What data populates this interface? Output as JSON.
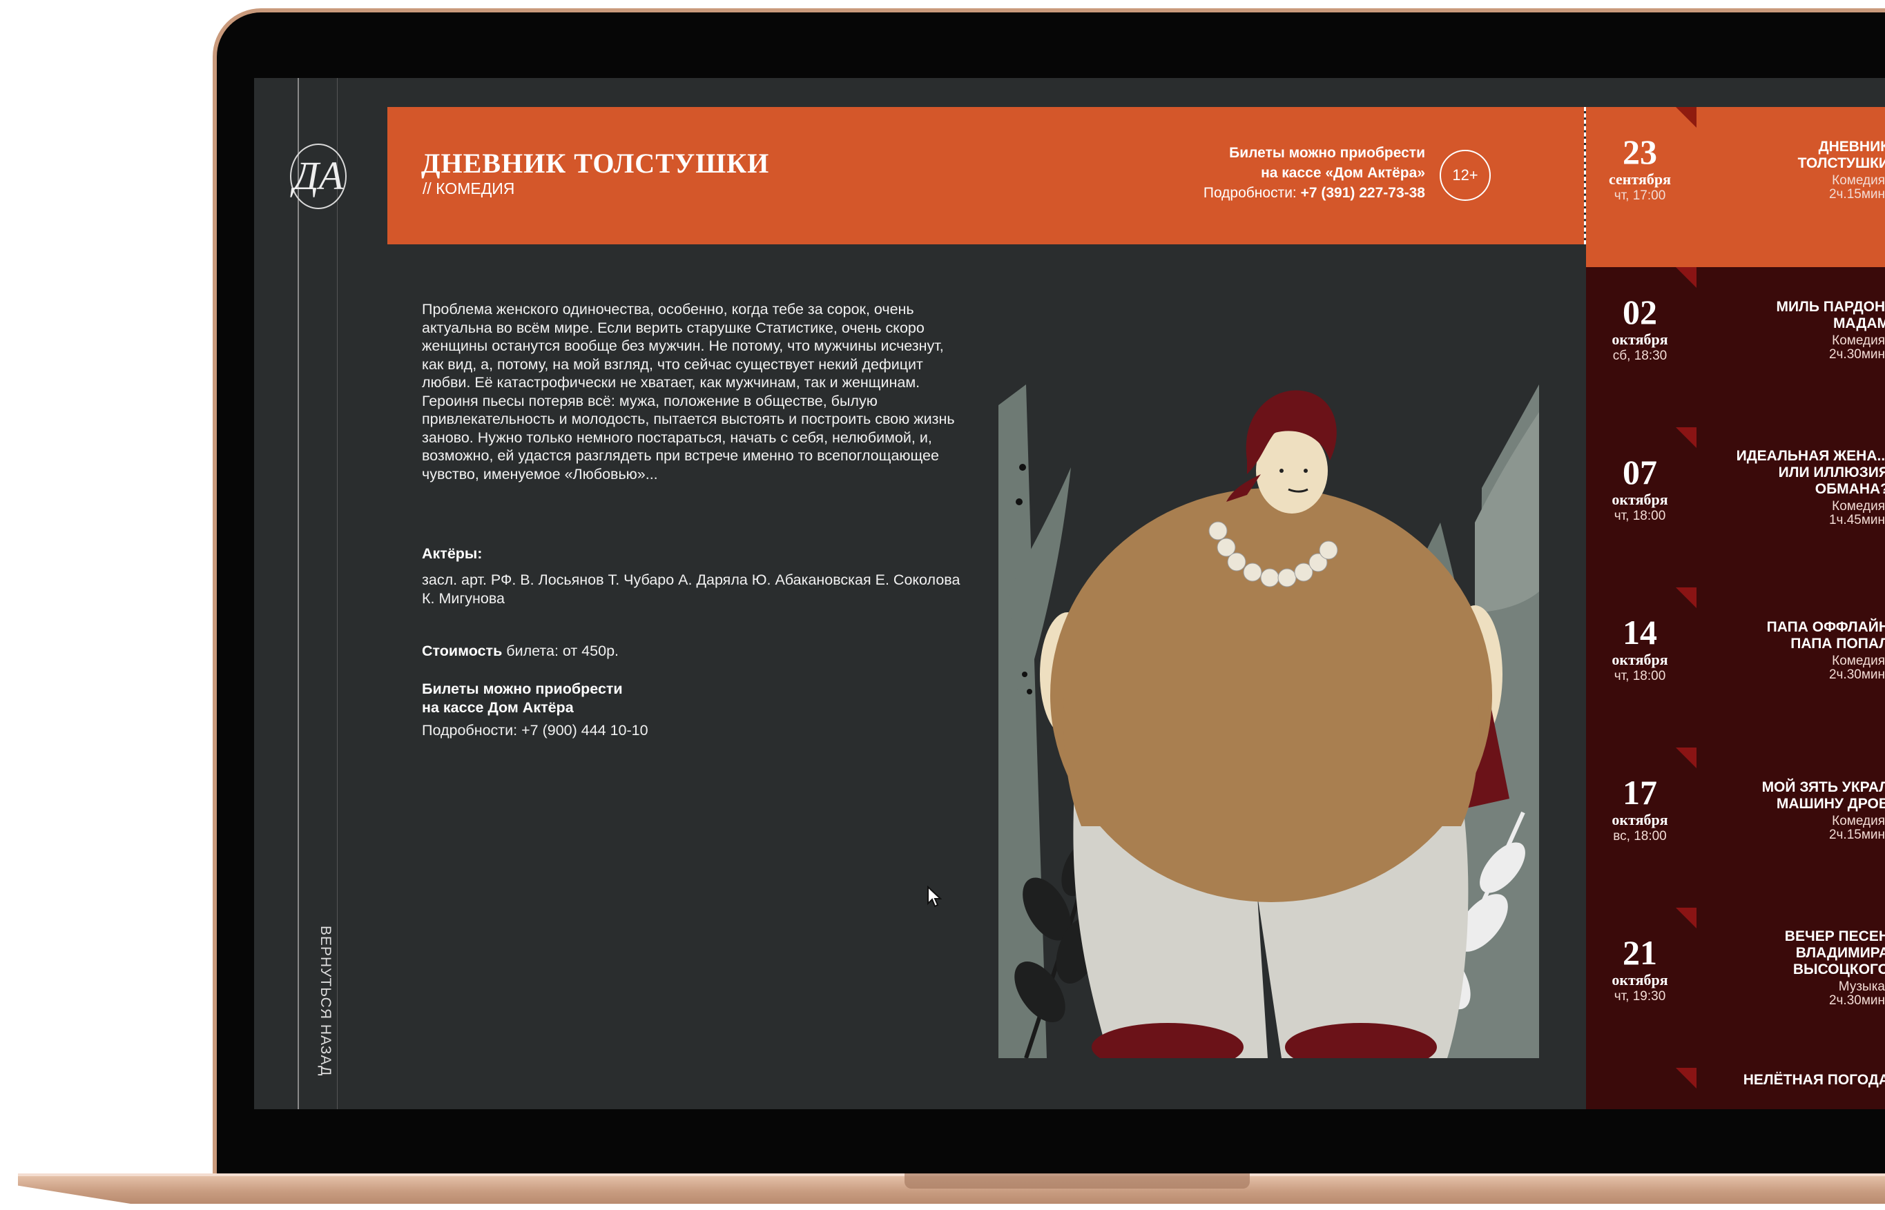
{
  "logo_letters": "ДА",
  "back_link": "ВЕРНУТЬСЯ НАЗАД",
  "header": {
    "title": "ДНЕВНИК ТОЛСТУШКИ",
    "genre": "// КОМЕДИЯ",
    "ticket_line1": "Билеты можно приобрести",
    "ticket_line2": "на кассе «Дом Актёра»",
    "details_label": "Подробности: ",
    "details_phone": "+7 (391) 227-73-38",
    "age_rating": "12+"
  },
  "description": "Проблема женского одиночества, особенно, когда тебе за сорок, очень актуальна во всём мире. Если верить старушке Статистике, очень скоро женщины останутся вообще без мужчин. Не потому, что мужчины исчезнут, как вид, а, потому, на мой взгляд, что сейчас существует некий дефицит любви. Её катастрофически не хватает, как мужчинам, так и женщинам. Героиня пьесы потеряв всё: мужа, положение в обществе, былую привлекательность и молодость, пытается выстоять и построить свою жизнь заново. Нужно только немного постараться, начать с себя, нелюбимой, и, возможно, ей удастся разглядеть при встрече именно то всепоглощающее чувство, именуемое «Любовью»...",
  "actors_heading": "Актёры:",
  "actors": "засл. арт. РФ. В. Лосьянов Т. Чубаро А. Даряла Ю. Абакановская Е. Соколова К. Мигунова",
  "price_label": "Стоимость",
  "price_value": " билета: от 450р.",
  "buy_line1": "Билеты можно приобрести",
  "buy_line2": "на кассе Дом Актёра",
  "contact": "Подробности: +7 (900) 444 10-10",
  "schedule": [
    {
      "day": "23",
      "month": "сентября",
      "time": "чт, 17:00",
      "name": [
        "ДНЕВНИК",
        "ТОЛСТУШКИ"
      ],
      "genre": "Комедия",
      "duration": "2ч.15мин"
    },
    {
      "day": "02",
      "month": "октября",
      "time": "сб, 18:30",
      "name": [
        "МИЛЬ ПАРДОН,",
        "МАДАМ"
      ],
      "genre": "Комедия",
      "duration": "2ч.30мин"
    },
    {
      "day": "07",
      "month": "октября",
      "time": "чт, 18:00",
      "name": [
        "ИДЕАЛЬНАЯ ЖЕНА...",
        "ИЛИ ИЛЛЮЗИЯ",
        "ОБМАНА?"
      ],
      "genre": "Комедия",
      "duration": "1ч.45мин"
    },
    {
      "day": "14",
      "month": "октября",
      "time": "чт, 18:00",
      "name": [
        "ПАПА ОФФЛАЙН",
        "ПАПА ПОПАЛ"
      ],
      "genre": "Комедия",
      "duration": "2ч.30мин"
    },
    {
      "day": "17",
      "month": "октября",
      "time": "вс, 18:00",
      "name": [
        "МОЙ ЗЯТЬ УКРАЛ",
        "МАШИНУ ДРОВ"
      ],
      "genre": "Комедия",
      "duration": "2ч.15мин"
    },
    {
      "day": "21",
      "month": "октября",
      "time": "чт, 19:30",
      "name": [
        "ВЕЧЕР ПЕСЕН",
        "ВЛАДИМИРА",
        "ВЫСОЦКОГО"
      ],
      "genre": "Музыка",
      "duration": "2ч.30мин"
    },
    {
      "day": "",
      "month": "",
      "time": "",
      "name": [
        "НЕЛЁТНАЯ ПОГОДА"
      ],
      "genre": "",
      "duration": ""
    }
  ]
}
